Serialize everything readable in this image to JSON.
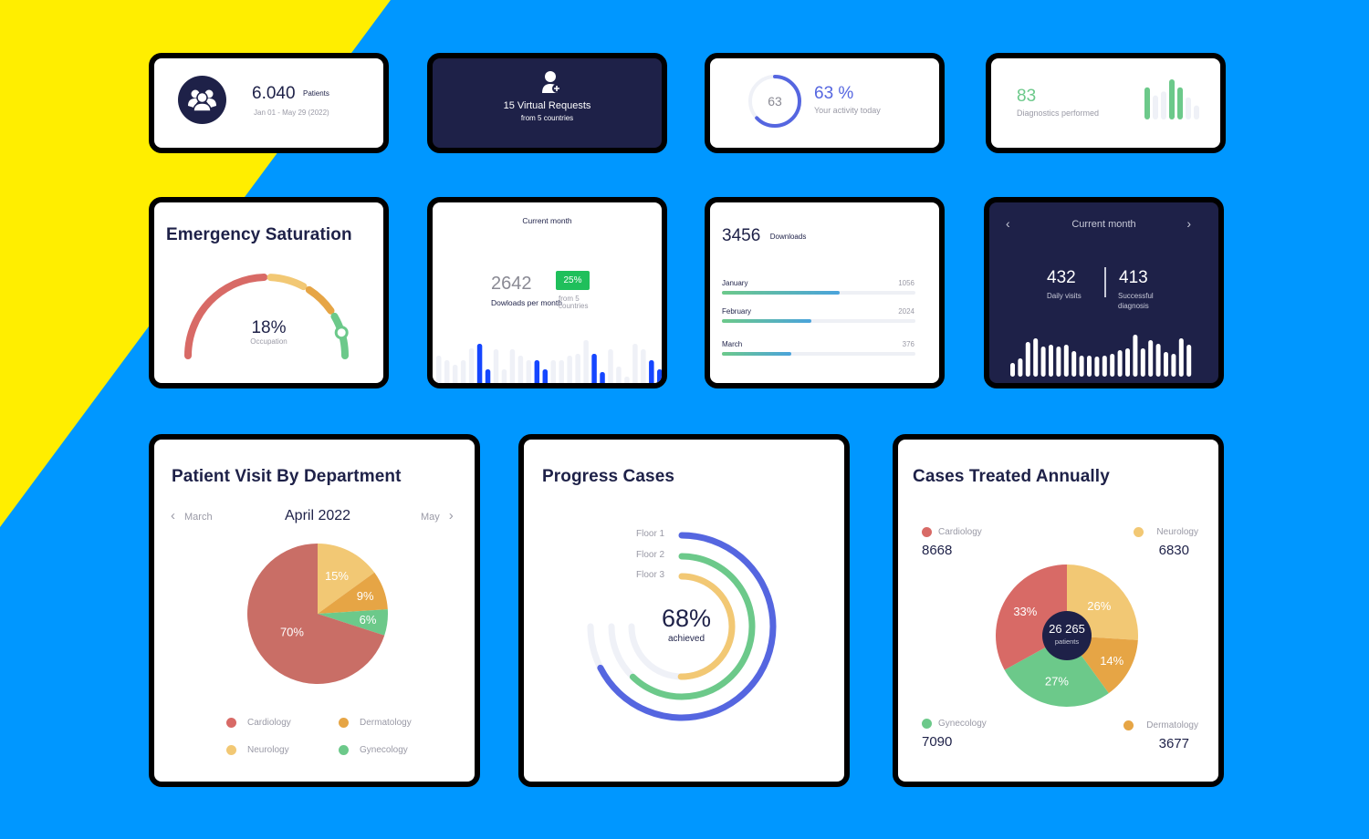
{
  "colors": {
    "background_blue": "#0097ff",
    "background_yellow": "#ffee00",
    "navy": "#1e2148",
    "red": "#d86a66",
    "yellow": "#f2c874",
    "orange": "#e6a545",
    "green": "#6cc98a",
    "blue_accent": "#5566e0",
    "bright_blue": "#1546ff",
    "light_track": "#eff1f7",
    "badge_green": "#1fbf5b"
  },
  "patients_card": {
    "icon": "users-group-icon",
    "value": "6.040",
    "unit": "Patients",
    "date_range": "Jan 01 - May 29 (2022)"
  },
  "virtual_card": {
    "icon": "user-add-icon",
    "title": "15 Virtual Requests",
    "subtitle": "from 5 countries"
  },
  "activity_card": {
    "ring_value": "63",
    "ring_fraction": 0.63,
    "value": "63 %",
    "label": "Your activity today"
  },
  "diagnostics_card": {
    "value": "83",
    "label": "Diagnostics performed",
    "bars": [
      {
        "v": 32,
        "highlight": true
      },
      {
        "v": 24,
        "highlight": false
      },
      {
        "v": 28,
        "highlight": false
      },
      {
        "v": 40,
        "highlight": true
      },
      {
        "v": 32,
        "highlight": true
      },
      {
        "v": 22,
        "highlight": false
      },
      {
        "v": 14,
        "highlight": false
      }
    ]
  },
  "emergency_card": {
    "title": "Emergency Saturation",
    "value": "18%",
    "label": "Occupation",
    "segments": [
      {
        "name": "red",
        "from": 0,
        "to": 0.49
      },
      {
        "name": "yellow",
        "from": 0.517,
        "to": 0.656
      },
      {
        "name": "orange",
        "from": 0.683,
        "to": 0.806
      },
      {
        "name": "green",
        "from": 0.833,
        "to": 1.0
      }
    ],
    "marker_fraction": 0.905
  },
  "downloads_month_card": {
    "header": "Current month",
    "value": "2642",
    "label": "Dowloads per month",
    "badge": "25%",
    "badge_sub": "from 5 countries",
    "bars": [
      {
        "v": 30,
        "h": false
      },
      {
        "v": 25,
        "h": false
      },
      {
        "v": 20,
        "h": false
      },
      {
        "v": 25,
        "h": false
      },
      {
        "v": 38,
        "h": false
      },
      {
        "v": 43,
        "h": true
      },
      {
        "v": 15,
        "h": true
      },
      {
        "v": 37,
        "h": false
      },
      {
        "v": 15,
        "h": false
      },
      {
        "v": 37,
        "h": false
      },
      {
        "v": 30,
        "h": false
      },
      {
        "v": 25,
        "h": false
      },
      {
        "v": 25,
        "h": true
      },
      {
        "v": 15,
        "h": true
      },
      {
        "v": 25,
        "h": false
      },
      {
        "v": 25,
        "h": false
      },
      {
        "v": 30,
        "h": false
      },
      {
        "v": 32,
        "h": false
      },
      {
        "v": 47,
        "h": false
      },
      {
        "v": 32,
        "h": true
      },
      {
        "v": 12,
        "h": true
      },
      {
        "v": 37,
        "h": false
      },
      {
        "v": 18,
        "h": false
      },
      {
        "v": 7,
        "h": false
      },
      {
        "v": 43,
        "h": false
      },
      {
        "v": 37,
        "h": false
      },
      {
        "v": 25,
        "h": true
      },
      {
        "v": 15,
        "h": true
      }
    ]
  },
  "downloads_card": {
    "value": "3456",
    "unit": "Downloads",
    "rows": [
      {
        "label": "January",
        "value": "1056",
        "fraction": 0.61
      },
      {
        "label": "February",
        "value": "2024",
        "fraction": 0.46
      },
      {
        "label": "March",
        "value": "376",
        "fraction": 0.36
      }
    ]
  },
  "visits_card": {
    "header": "Current month",
    "prev_icon": "chevron-left-icon",
    "next_icon": "chevron-right-icon",
    "daily_visits": "432",
    "daily_visits_label": "Daily visits",
    "successful": "413",
    "successful_label_1": "Successful",
    "successful_label_2": "diagnosis",
    "bars": [
      15,
      20,
      38,
      42,
      33,
      35,
      33,
      35,
      28,
      23,
      23,
      22,
      23,
      25,
      29,
      31,
      46,
      31,
      40,
      36,
      27,
      25,
      42,
      35
    ]
  },
  "department_card": {
    "title": "Patient Visit By Department",
    "prev_label": "March",
    "current_label": "April 2022",
    "next_label": "May",
    "legend": [
      {
        "label": "Cardiology",
        "color": "#d86a66"
      },
      {
        "label": "Dermatology",
        "color": "#e6a545"
      },
      {
        "label": "Neurology",
        "color": "#f2c874"
      },
      {
        "label": "Gynecology",
        "color": "#6cc98a"
      }
    ]
  },
  "progress_card": {
    "title": "Progress Cases",
    "value": "68%",
    "label": "achieved",
    "rings": [
      {
        "label": "Floor 1",
        "fraction": 0.9,
        "color": "#5566e0"
      },
      {
        "label": "Floor 2",
        "fraction": 0.83,
        "color": "#6cc98a"
      },
      {
        "label": "Floor 3",
        "fraction": 0.67,
        "color": "#f2c874"
      }
    ]
  },
  "annual_card": {
    "title": "Cases Treated Annually",
    "center_value": "26 265",
    "center_label": "patients",
    "legend": [
      {
        "label": "Cardiology",
        "value": "8668",
        "color": "#d86a66"
      },
      {
        "label": "Neurology",
        "value": "6830",
        "color": "#f2c874"
      },
      {
        "label": "Gynecology",
        "value": "7090",
        "color": "#6cc98a"
      },
      {
        "label": "Dermatology",
        "value": "3677",
        "color": "#e6a545"
      }
    ]
  },
  "chart_data": [
    {
      "type": "pie",
      "title": "Patient Visit By Department",
      "subtitle": "April 2022",
      "categories": [
        "Neurology",
        "Dermatology",
        "Gynecology",
        "Cardiology"
      ],
      "values": [
        15,
        9,
        6,
        70
      ],
      "labels": [
        "15%",
        "9%",
        "6%",
        "70%"
      ],
      "colors": [
        "#f2c874",
        "#e6a545",
        "#6cc98a",
        "#c96e66"
      ],
      "legend": "bottom"
    },
    {
      "type": "pie",
      "title": "Cases Treated Annually",
      "categories": [
        "Neurology",
        "Dermatology",
        "Gynecology",
        "Cardiology"
      ],
      "values": [
        26,
        14,
        27,
        33
      ],
      "labels": [
        "26%",
        "14%",
        "27%",
        "33%"
      ],
      "counts": [
        6830,
        3677,
        7090,
        8668
      ],
      "colors": [
        "#f2c874",
        "#e6a545",
        "#6cc98a",
        "#d86a66"
      ],
      "center_text": "26 265 patients",
      "legend": "corners"
    },
    {
      "type": "radial-progress",
      "title": "Progress Cases",
      "categories": [
        "Floor 1",
        "Floor 2",
        "Floor 3"
      ],
      "values": [
        0.9,
        0.83,
        0.67
      ],
      "summary": "68% achieved"
    }
  ]
}
